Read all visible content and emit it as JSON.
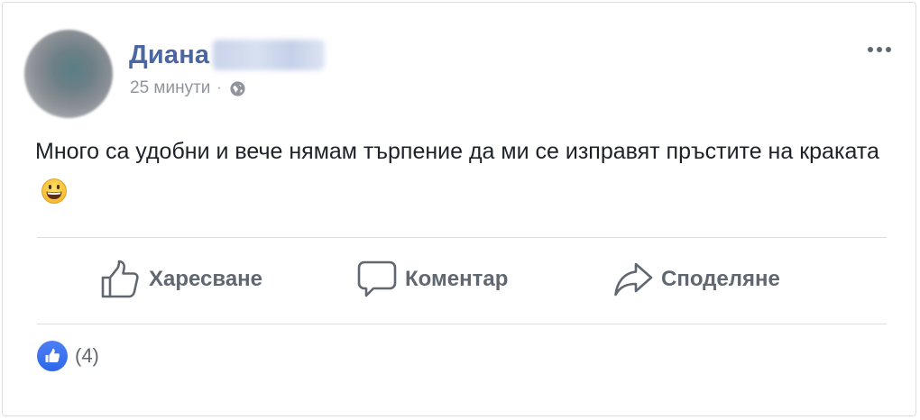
{
  "post": {
    "author_first_name": "Диана",
    "time": "25 минути",
    "separator": "·",
    "privacy_icon": "globe-icon",
    "text": "Много са удобни и вече нямам търпение да ми се изправят пръстите на краката",
    "emoji": "grinning-face-icon"
  },
  "actions": {
    "like_label": "Харесване",
    "comment_label": "Коментар",
    "share_label": "Споделяне"
  },
  "reactions": {
    "count": "(4)",
    "icon": "like-badge-icon",
    "color": "#3b73ed"
  },
  "colors": {
    "author": "#4b67a1",
    "meta": "#90949c",
    "action": "#616770"
  }
}
